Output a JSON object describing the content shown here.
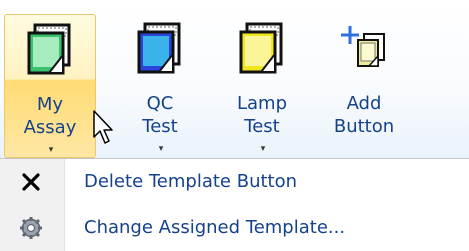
{
  "ribbon": {
    "buttons": [
      {
        "line1": "My",
        "line2": "Assay",
        "has_dropdown": true,
        "icon": "green-template-icon",
        "active": true
      },
      {
        "line1": "QC",
        "line2": "Test",
        "has_dropdown": true,
        "icon": "blue-template-icon",
        "active": false
      },
      {
        "line1": "Lamp",
        "line2": "Test",
        "has_dropdown": true,
        "icon": "yellow-template-icon",
        "active": false
      },
      {
        "line1": "Add",
        "line2": "Button",
        "has_dropdown": false,
        "icon": "add-template-icon",
        "active": false
      }
    ],
    "dropdown_glyph": "▾"
  },
  "menu": {
    "items": [
      {
        "label": "Delete Template Button",
        "icon": "close-icon"
      },
      {
        "label": "Change Assigned Template...",
        "icon": "gear-icon"
      }
    ]
  },
  "colors": {
    "label_text": "#15428b",
    "hover_fill": "#ffdb73",
    "green": "#3ac16b",
    "blue": "#2b43d9",
    "yellow": "#f2e621"
  }
}
